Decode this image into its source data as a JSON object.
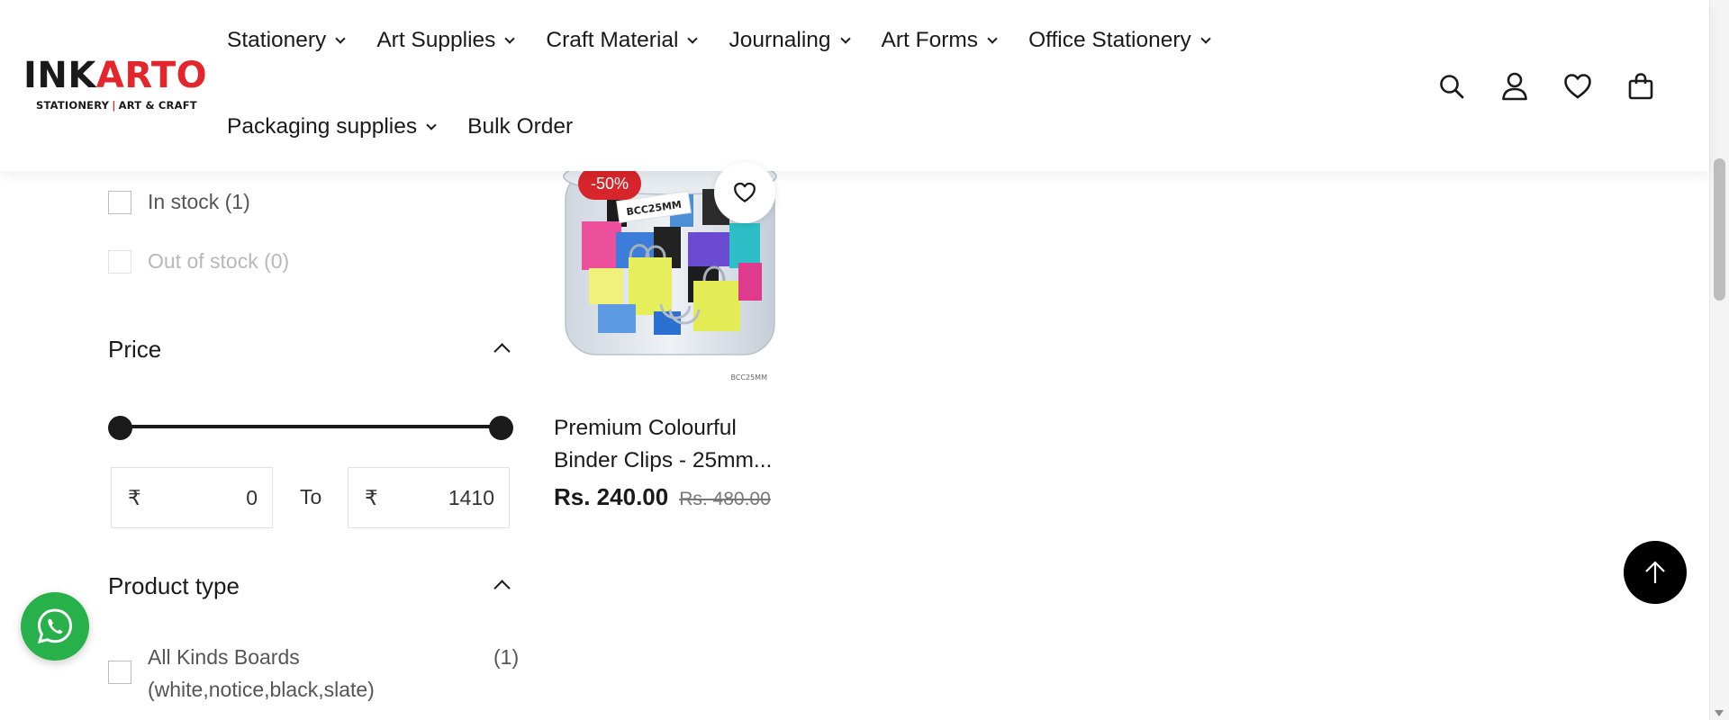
{
  "brand": {
    "logo_main_dark": "INK",
    "logo_main_accent": "ARTO",
    "logo_tag_left": "STATIONERY",
    "logo_tag_sep": "|",
    "logo_tag_right": "ART & CRAFT"
  },
  "nav": {
    "row1": [
      {
        "label": "Stationery",
        "has_dropdown": true
      },
      {
        "label": "Art Supplies",
        "has_dropdown": true
      },
      {
        "label": "Craft Material",
        "has_dropdown": true
      },
      {
        "label": "Journaling",
        "has_dropdown": true
      },
      {
        "label": "Art Forms",
        "has_dropdown": true
      },
      {
        "label": "Office Stationery",
        "has_dropdown": true
      }
    ],
    "row2": [
      {
        "label": "Packaging supplies",
        "has_dropdown": true
      },
      {
        "label": "Bulk Order",
        "has_dropdown": false
      }
    ]
  },
  "header_icons": [
    "search-icon",
    "account-icon",
    "wishlist-icon",
    "cart-icon"
  ],
  "filters": {
    "availability": [
      {
        "label": "In stock (1)",
        "enabled": true
      },
      {
        "label": "Out of stock (0)",
        "enabled": false
      }
    ],
    "price": {
      "title": "Price",
      "currency_symbol": "₹",
      "min_value": "0",
      "max_value": "1410",
      "to_label": "To",
      "range_selected": [
        0,
        1410
      ]
    },
    "product_type": {
      "title": "Product type",
      "items": [
        {
          "label": "All Kinds Boards (white,notice,black,slate)",
          "count": "(1)"
        }
      ]
    }
  },
  "product": {
    "discount_badge": "-50%",
    "image_label": "BCC25MM",
    "image_caption": "BCC25MM",
    "title": "Premium Colourful Binder Clips - 25mm...",
    "price": "Rs. 240.00",
    "compare_price": "Rs. 480.00"
  },
  "colors": {
    "accent": "#e4262c",
    "badge": "#d7262b",
    "whatsapp": "#28b04a",
    "text": "#1a1a1a"
  },
  "floating": {
    "whatsapp_icon": "whatsapp-icon",
    "back_to_top_icon": "arrow-up-icon"
  }
}
